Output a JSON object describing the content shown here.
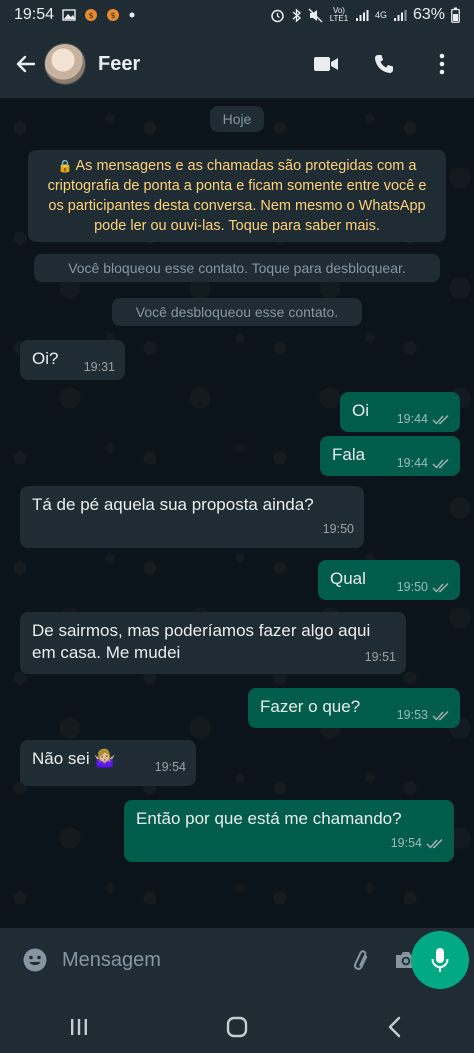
{
  "status_bar": {
    "time": "19:54",
    "network_label": "Vo) LTE1",
    "network_type": "4G",
    "battery": "63%",
    "icons": [
      "gallery-icon",
      "notification-icon",
      "dot-icon",
      "alarm-icon",
      "bluetooth-icon",
      "mute-icon",
      "signal-icon",
      "battery-icon"
    ]
  },
  "header": {
    "contact_name": "Feer",
    "icons": [
      "back-arrow-icon",
      "video-call-icon",
      "phone-icon",
      "more-vert-icon"
    ]
  },
  "chat": {
    "date_pill": "Hoje",
    "encryption_notice": "As mensagens e as chamadas são protegidas com a criptografia de ponta a ponta e ficam somente entre você e os participantes desta conversa. Nem mesmo o WhatsApp pode ler ou ouvi-las. Toque para saber mais.",
    "system_messages": [
      "Você bloqueou esse contato. Toque para desbloquear.",
      "Você desbloqueou esse contato."
    ],
    "messages": [
      {
        "direction": "in",
        "text": "Oi?",
        "time": "19:31"
      },
      {
        "direction": "out",
        "text": "Oi",
        "time": "19:44",
        "status": "read"
      },
      {
        "direction": "out",
        "text": "Fala",
        "time": "19:44",
        "status": "read"
      },
      {
        "direction": "in",
        "text": "Tá de pé aquela sua proposta ainda?",
        "time": "19:50"
      },
      {
        "direction": "out",
        "text": "Qual",
        "time": "19:50",
        "status": "read"
      },
      {
        "direction": "in",
        "text": "De sairmos, mas poderíamos fazer algo aqui em casa. Me mudei",
        "time": "19:51"
      },
      {
        "direction": "out",
        "text": "Fazer o que?",
        "time": "19:53",
        "status": "read"
      },
      {
        "direction": "in",
        "text": "Não sei 🤷🏼‍♀️",
        "time": "19:54"
      },
      {
        "direction": "out",
        "text": "Então por que está me chamando?",
        "time": "19:54",
        "status": "read"
      }
    ]
  },
  "input_bar": {
    "placeholder": "Mensagem"
  },
  "colors": {
    "header_bg": "#1f2c34",
    "chat_bg": "#0b141a",
    "incoming_bubble": "#202c33",
    "outgoing_bubble": "#005c4b",
    "accent": "#00a884",
    "notice_text": "#ffd279",
    "read_check": "#8696a0"
  }
}
